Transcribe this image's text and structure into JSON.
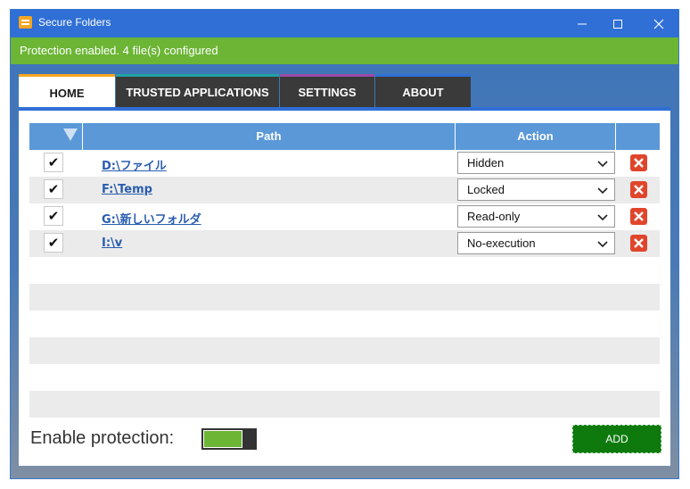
{
  "window": {
    "title": "Secure Folders"
  },
  "status": {
    "text": "Protection enabled. 4 file(s) configured"
  },
  "tabs": [
    {
      "label": "HOME",
      "accent": "#f5a623"
    },
    {
      "label": "TRUSTED APPLICATIONS",
      "accent": "#1fa3a3"
    },
    {
      "label": "SETTINGS",
      "accent": "#9b4aa8"
    },
    {
      "label": "ABOUT",
      "accent": "#2f6fd6"
    }
  ],
  "table": {
    "columns": {
      "path": "Path",
      "action": "Action"
    },
    "rows": [
      {
        "checked": "✔",
        "path": "D:\\ファイル",
        "action": "Hidden"
      },
      {
        "checked": "✔",
        "path": "F:\\Temp",
        "action": "Locked"
      },
      {
        "checked": "✔",
        "path": "G:\\新しいフォルダ",
        "action": "Read-only"
      },
      {
        "checked": "✔",
        "path": "I:\\v",
        "action": "No-execution"
      }
    ]
  },
  "footer": {
    "enable_label": "Enable protection:",
    "toggle_on": true,
    "add_label": "ADD"
  },
  "colors": {
    "titlebar": "#2f6fd6",
    "status": "#6cb535",
    "add_button": "#0e7a0e",
    "delete": "#e0452b"
  }
}
